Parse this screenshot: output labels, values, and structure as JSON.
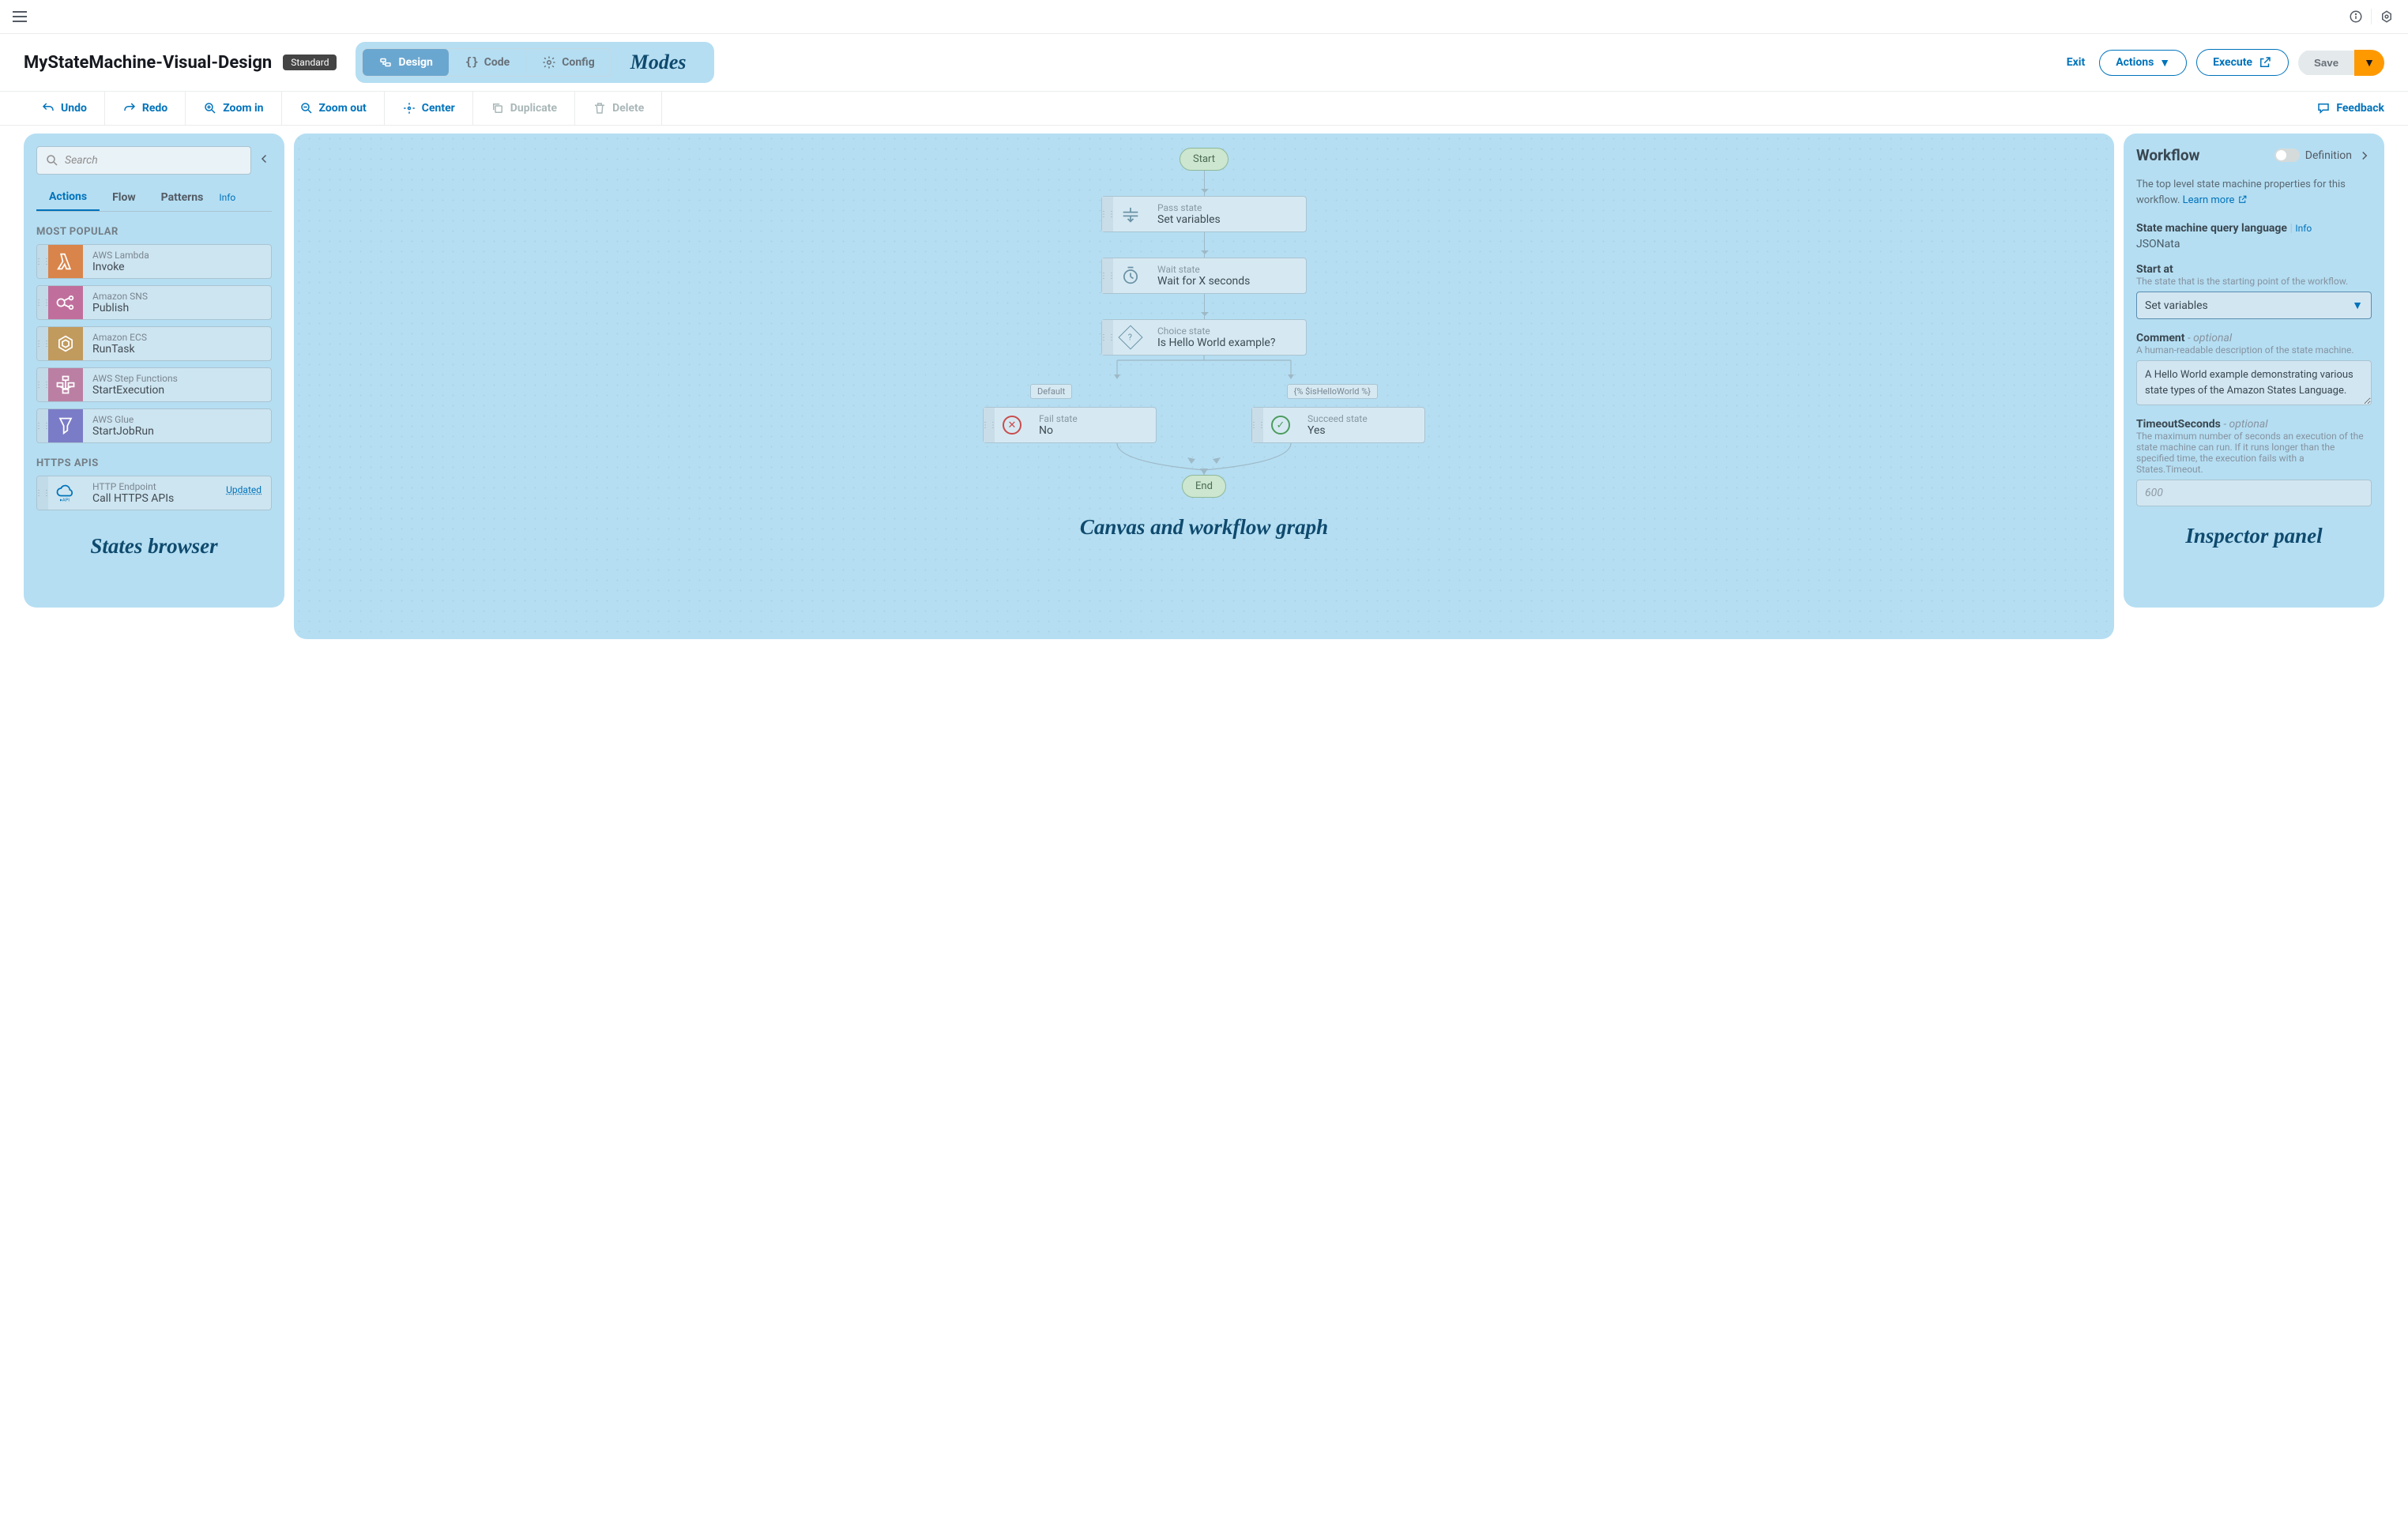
{
  "header": {
    "title": "MyStateMachine-Visual-Design",
    "badge": "Standard",
    "modes_label": "Modes",
    "modes": {
      "design": "Design",
      "code": "Code",
      "config": "Config"
    },
    "actions": {
      "exit": "Exit",
      "actions_btn": "Actions",
      "execute_btn": "Execute",
      "save": "Save"
    }
  },
  "toolbar": {
    "undo": "Undo",
    "redo": "Redo",
    "zoom_in": "Zoom in",
    "zoom_out": "Zoom out",
    "center": "Center",
    "duplicate": "Duplicate",
    "delete": "Delete",
    "feedback": "Feedback"
  },
  "states_browser": {
    "search_placeholder": "Search",
    "tabs": {
      "actions": "Actions",
      "flow": "Flow",
      "patterns": "Patterns",
      "info": "Info"
    },
    "section_popular": "MOST POPULAR",
    "section_https": "HTTPS APIS",
    "label": "States browser",
    "items": [
      {
        "sub": "AWS Lambda",
        "main": "Invoke"
      },
      {
        "sub": "Amazon SNS",
        "main": "Publish"
      },
      {
        "sub": "Amazon ECS",
        "main": "RunTask"
      },
      {
        "sub": "AWS Step Functions",
        "main": "StartExecution"
      },
      {
        "sub": "AWS Glue",
        "main": "StartJobRun"
      }
    ],
    "http_item": {
      "sub": "HTTP Endpoint",
      "main": "Call HTTPS APIs",
      "badge": "Updated"
    }
  },
  "canvas": {
    "label": "Canvas and workflow graph",
    "start": "Start",
    "end": "End",
    "nodes": {
      "pass": {
        "sub": "Pass state",
        "main": "Set variables"
      },
      "wait": {
        "sub": "Wait state",
        "main": "Wait for X seconds"
      },
      "choice": {
        "sub": "Choice state",
        "main": "Is Hello World example?"
      },
      "fail": {
        "sub": "Fail state",
        "main": "No"
      },
      "succeed": {
        "sub": "Succeed state",
        "main": "Yes"
      }
    },
    "edges": {
      "default": "Default",
      "cond": "{% $isHelloWorld %}"
    }
  },
  "inspector": {
    "title": "Workflow",
    "toggle_label": "Definition",
    "label": "Inspector panel",
    "desc": "The top level state machine properties for this workflow.",
    "learn": "Learn more",
    "ql_label": "State machine query language",
    "info": "Info",
    "ql_val": "JSONata",
    "startat_label": "Start at",
    "startat_hint": "The state that is the starting point of the workflow.",
    "startat_val": "Set variables",
    "comment_label": "Comment",
    "optional": "- optional",
    "comment_hint": "A human-readable description of the state machine.",
    "comment_val": "A Hello World example demonstrating various state types of the Amazon States Language.",
    "timeout_label": "TimeoutSeconds",
    "timeout_hint": "The maximum number of seconds an execution of the state machine can run. If it runs longer than the specified time, the execution fails with a States.Timeout.",
    "timeout_placeholder": "600"
  }
}
